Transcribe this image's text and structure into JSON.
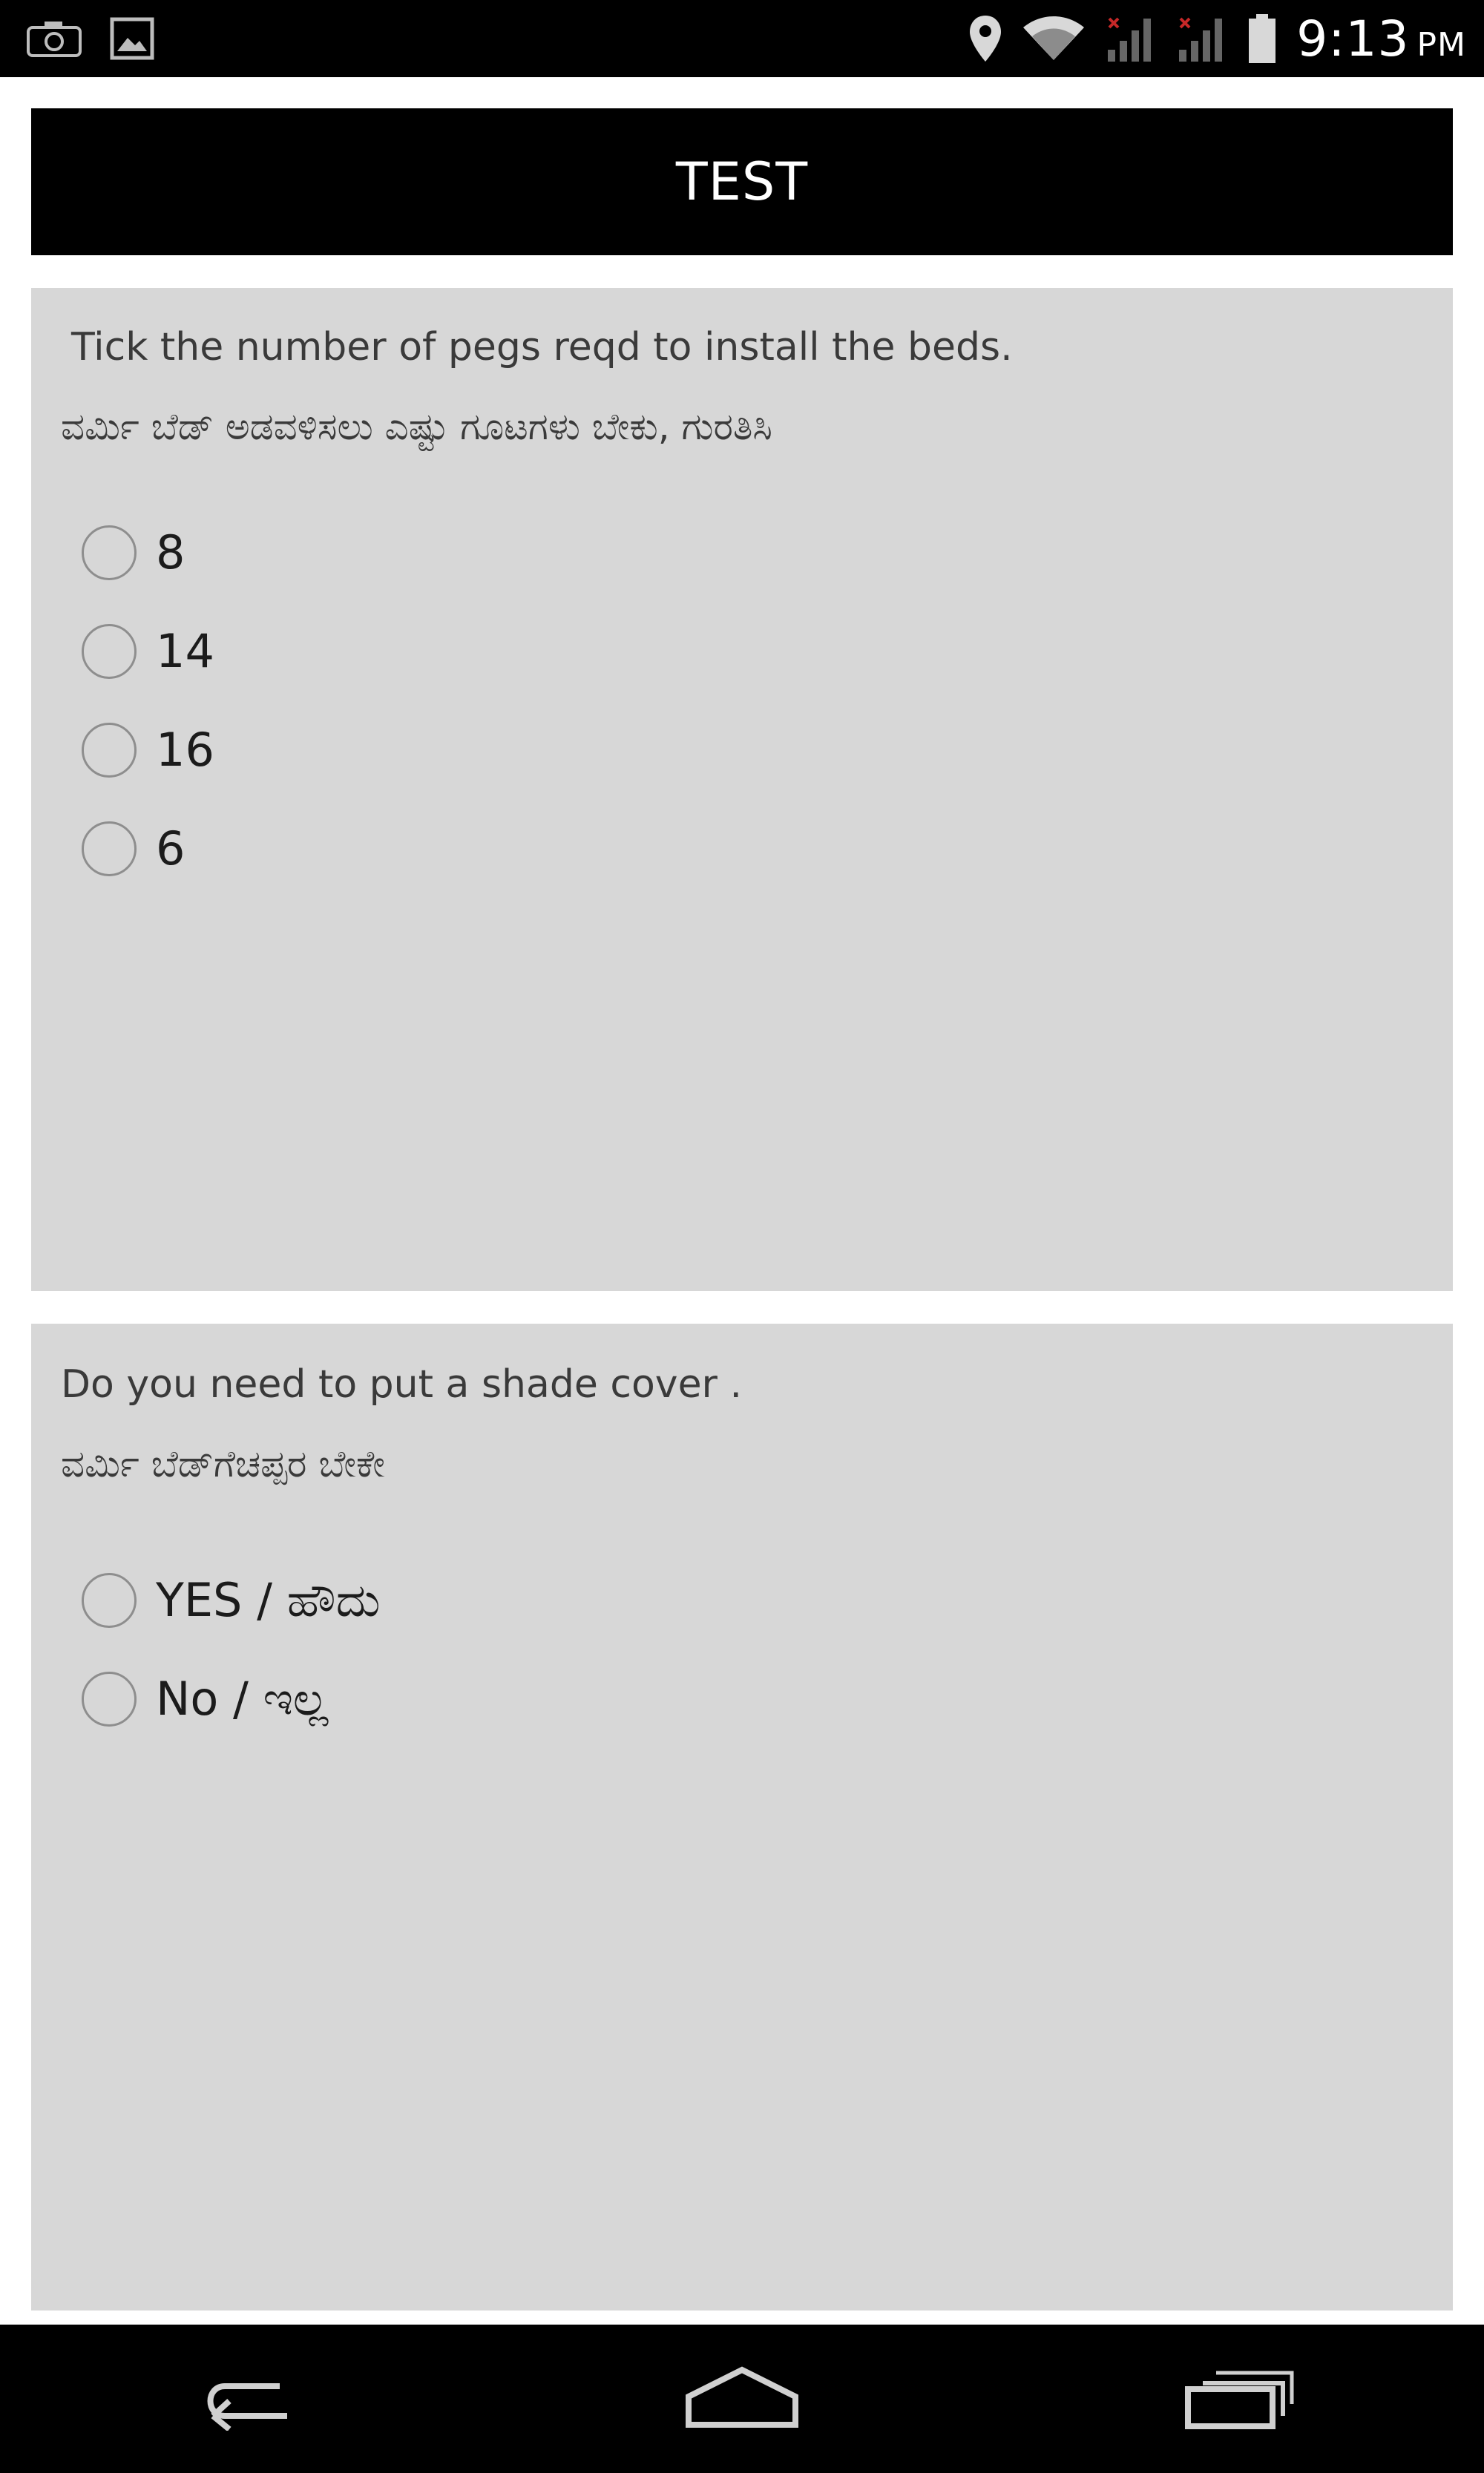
{
  "status_bar": {
    "time": "9:13",
    "ampm": "PM",
    "icons": [
      "camera-icon",
      "image-icon",
      "location-icon",
      "wifi-icon",
      "signal-icon",
      "signal-icon",
      "battery-icon"
    ]
  },
  "header": {
    "title": "TEST"
  },
  "questions": [
    {
      "text_en": "Tick the number of pegs reqd to install the beds.",
      "text_kn": "ವರ್ಮಿ ಬೆಡ್ ಅಡವಳಿಸಲು ಎಷ್ಟು ಗೂಟಗಳು ಬೇಕು, ಗುರತಿಸಿ",
      "options": [
        {
          "label": "8",
          "selected": false
        },
        {
          "label": "14",
          "selected": false
        },
        {
          "label": "16",
          "selected": false
        },
        {
          "label": "6",
          "selected": false
        }
      ]
    },
    {
      "text_en": "Do you need to put a shade cover .",
      "text_kn": "ವರ್ಮಿ ಬೆಡ್‌ಗೆಚಪ್ಪರ ಬೇಕೇ",
      "options": [
        {
          "label": "YES / ಹೌದು",
          "selected": false
        },
        {
          "label": "No / ಇಲ್ಲ",
          "selected": false
        }
      ]
    }
  ],
  "nav_bar": {
    "icons": [
      "back-icon",
      "home-icon",
      "recents-icon"
    ]
  },
  "colors": {
    "status_bar_bg": "#000000",
    "title_bar_bg": "#000000",
    "card_bg": "#d7d7d7",
    "page_bg": "#ffffff"
  }
}
